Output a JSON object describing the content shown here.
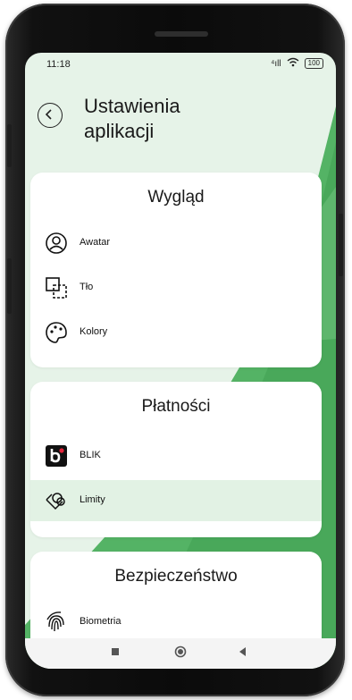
{
  "status_bar": {
    "time": "11:18",
    "signal": "⁴ıll",
    "battery": "100"
  },
  "header": {
    "title_line1": "Ustawienia",
    "title_line2": "aplikacji"
  },
  "sections": {
    "appearance": {
      "title": "Wygląd",
      "items": [
        {
          "label": "Awatar",
          "icon": "user-circle-icon"
        },
        {
          "label": "Tło",
          "icon": "background-icon"
        },
        {
          "label": "Kolory",
          "icon": "palette-icon"
        }
      ]
    },
    "payments": {
      "title": "Płatności",
      "items": [
        {
          "label": "BLIK",
          "icon": "blik-icon"
        },
        {
          "label": "Limity",
          "icon": "limits-icon"
        }
      ]
    },
    "security": {
      "title": "Bezpieczeństwo",
      "items": [
        {
          "label": "Biometria",
          "icon": "fingerprint-icon"
        }
      ]
    }
  },
  "colors": {
    "accent": "#4cae5a",
    "accent_light": "#e2f2e4",
    "blik_dot": "#e2243b"
  }
}
